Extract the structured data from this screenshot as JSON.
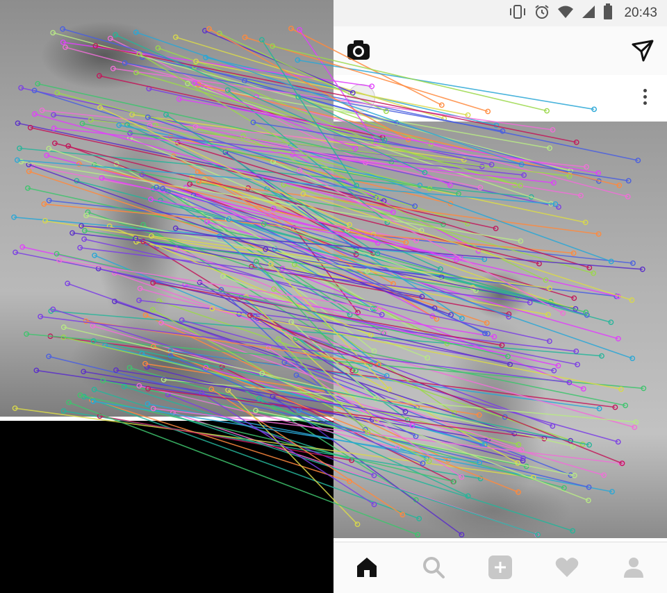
{
  "status_bar": {
    "time": "20:43",
    "icons": [
      "vibrate-icon",
      "alarm-icon",
      "wifi-icon",
      "signal-icon",
      "battery-icon"
    ]
  },
  "app_header": {
    "title": "",
    "left_icon": "camera-icon",
    "right_icon": "direct-message-icon"
  },
  "post": {
    "username": "",
    "menu_icon": "more-vertical-icon"
  },
  "bottom_nav": {
    "items": [
      "home-icon",
      "search-icon",
      "add-post-icon",
      "heart-icon",
      "profile-icon"
    ]
  },
  "overlay": {
    "line_colors": [
      "#7b3fe4",
      "#3ec46d",
      "#e040fb",
      "#2aa7d6",
      "#9bd84a",
      "#f06fd8",
      "#4a5fe0",
      "#d9d94a",
      "#26b59a",
      "#ff8a3d",
      "#b8e986",
      "#5b2fc9",
      "#c2185b"
    ]
  }
}
